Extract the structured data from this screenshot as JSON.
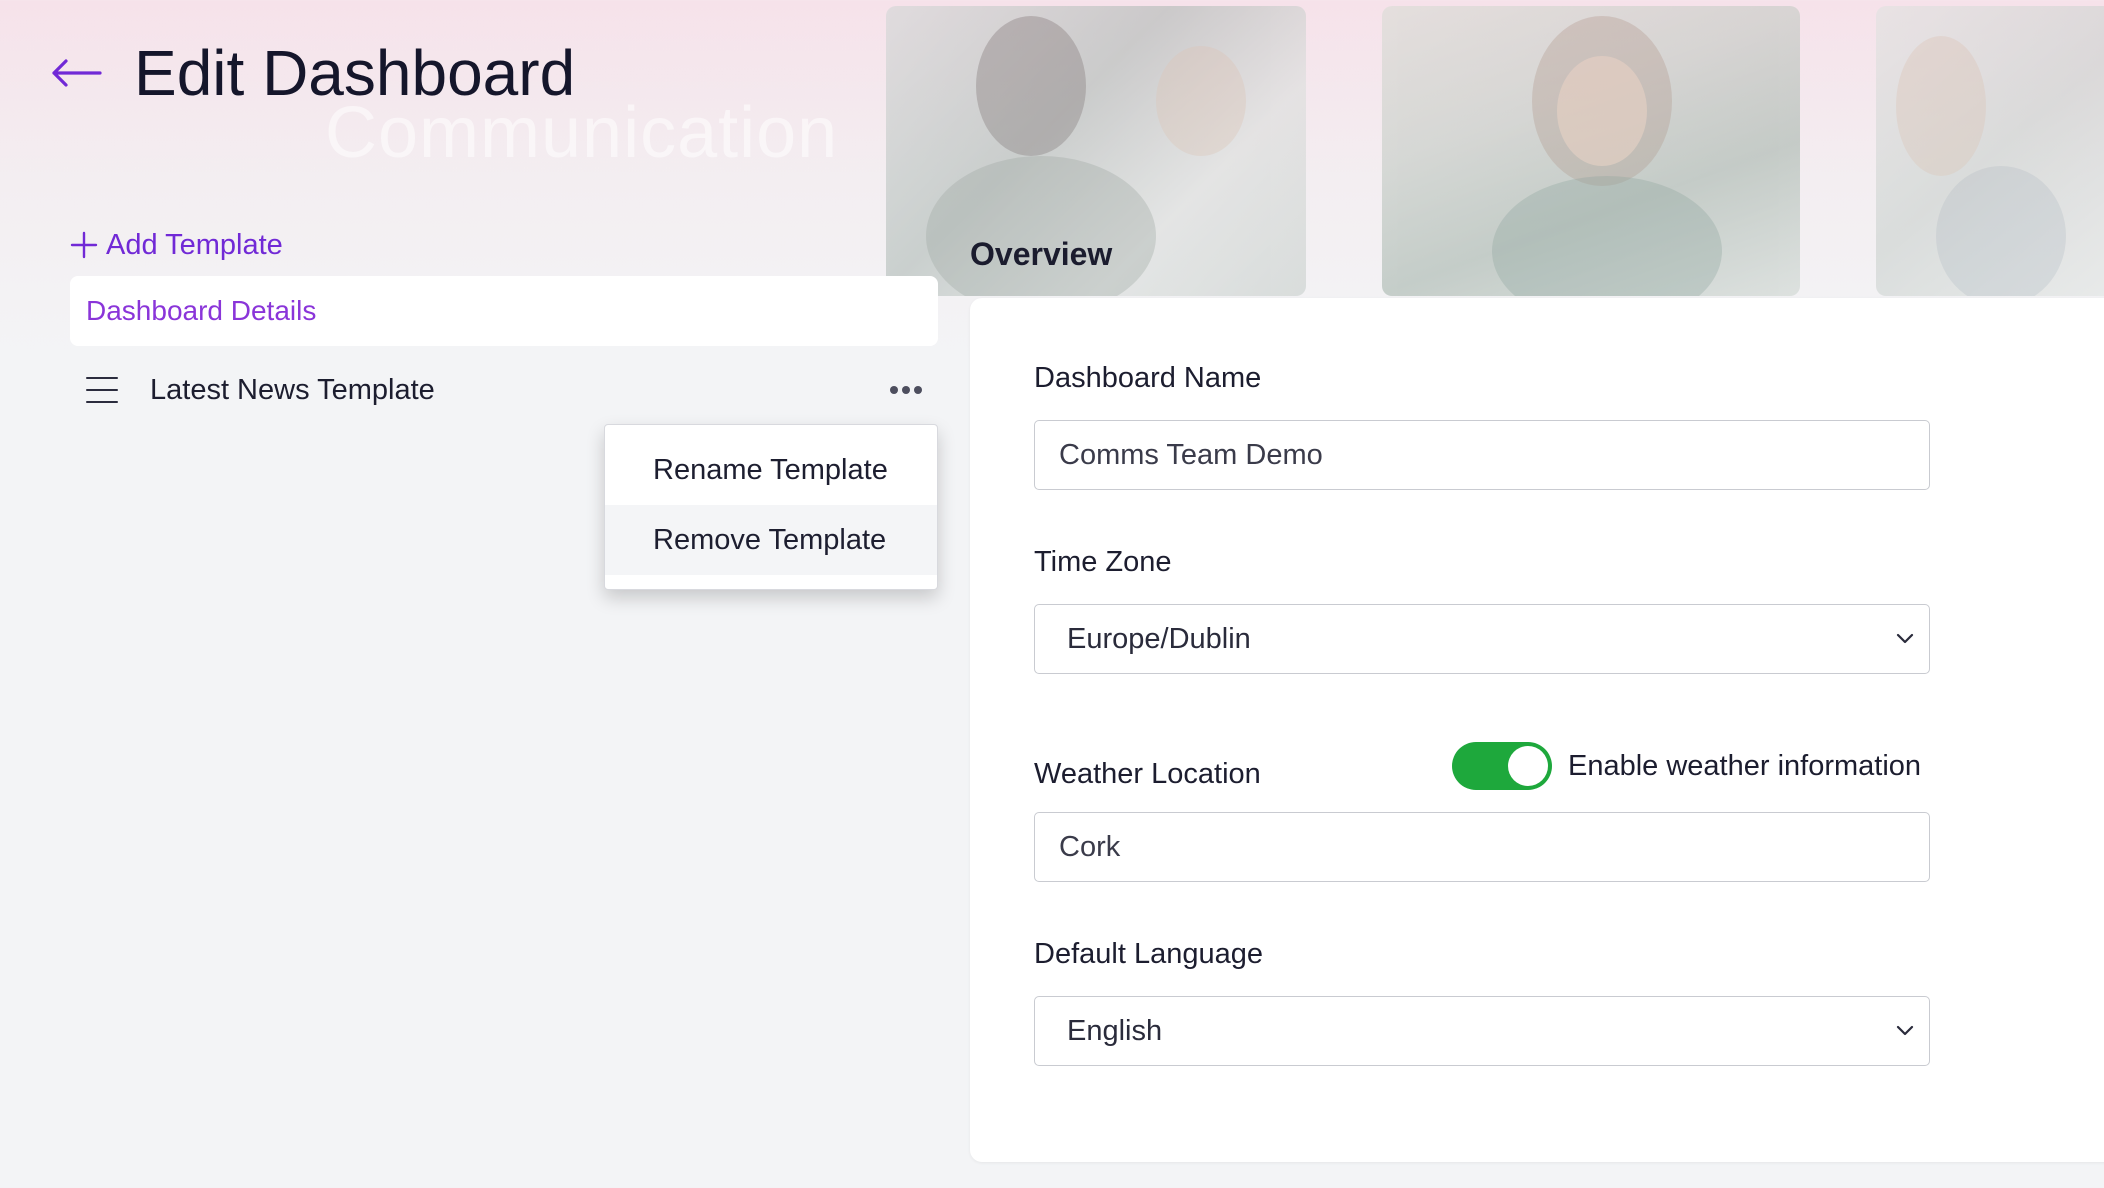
{
  "header": {
    "title": "Edit Dashboard",
    "hero_text": "Communication"
  },
  "sidebar": {
    "add_template_label": "Add Template",
    "details_label": "Dashboard Details",
    "template_name": "Latest News Template"
  },
  "context_menu": {
    "items": [
      {
        "label": "Rename Template"
      },
      {
        "label": "Remove Template"
      }
    ]
  },
  "overview": {
    "title": "Overview",
    "dashboard_name": {
      "label": "Dashboard Name",
      "value": "Comms Team Demo"
    },
    "time_zone": {
      "label": "Time Zone",
      "value": "Europe/Dublin"
    },
    "weather": {
      "label": "Weather Location",
      "value": "Cork",
      "toggle_label": "Enable weather information",
      "enabled": true
    },
    "language": {
      "label": "Default Language",
      "value": "English"
    }
  },
  "colors": {
    "accent": "#7129d6",
    "toggle_on": "#1ea83c"
  },
  "icons": [
    "back-arrow-icon",
    "plus-icon",
    "drag-handle-icon",
    "more-options-icon",
    "chevron-down-icon"
  ]
}
